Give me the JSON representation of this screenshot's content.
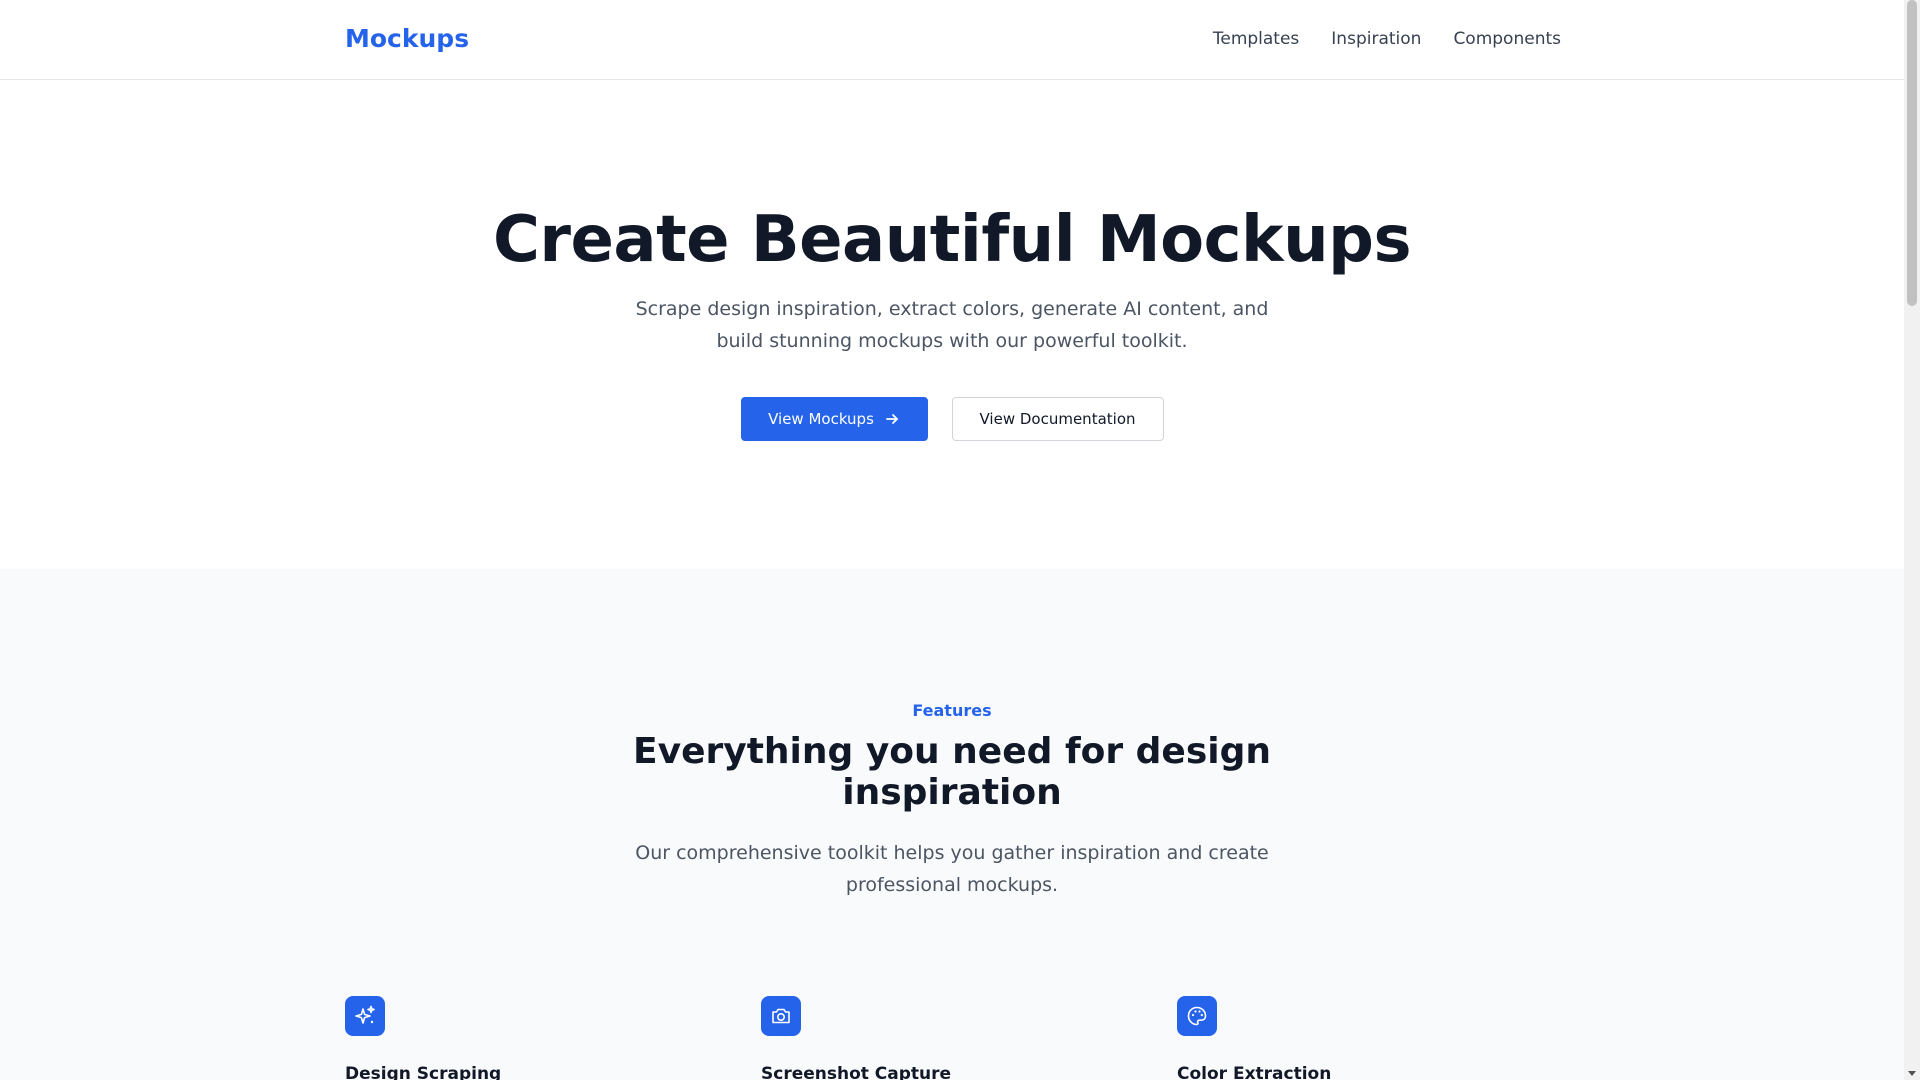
{
  "header": {
    "logo": "Mockups",
    "nav": [
      "Templates",
      "Inspiration",
      "Components"
    ]
  },
  "hero": {
    "title": "Create Beautiful Mockups",
    "subtitle": "Scrape design inspiration, extract colors, generate AI content, and build stunning mockups with our powerful toolkit.",
    "primary_button": "View Mockups",
    "secondary_button": "View Documentation"
  },
  "features": {
    "eyebrow": "Features",
    "title": "Everything you need for design inspiration",
    "subtitle": "Our comprehensive toolkit helps you gather inspiration and create professional mockups.",
    "items": [
      {
        "title": "Design Scraping",
        "icon": "sparkles-icon"
      },
      {
        "title": "Screenshot Capture",
        "icon": "camera-icon"
      },
      {
        "title": "Color Extraction",
        "icon": "palette-icon"
      }
    ]
  },
  "colors": {
    "accent": "#2563eb",
    "heading": "#111827",
    "body_text": "#4b5563",
    "section_bg": "#f9fafb"
  }
}
